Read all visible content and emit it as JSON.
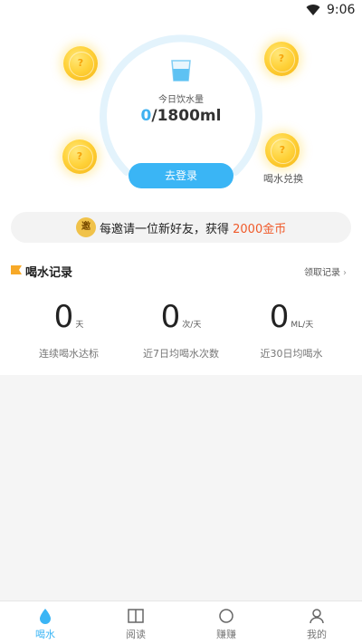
{
  "status_bar": {
    "time": "9:06"
  },
  "water": {
    "today_label": "今日饮水量",
    "current": "0",
    "goal": "/1800ml",
    "login_label": "去登录",
    "exchange_label": "喝水兑换",
    "coin_mark": "?"
  },
  "invite": {
    "badge": "邀",
    "text": "每邀请一位新好友，获得 ",
    "reward": "2000金币"
  },
  "records": {
    "title": "喝水记录",
    "more_label": "领取记录",
    "stats": [
      {
        "value": "0",
        "unit": "天",
        "label": "连续喝水达标"
      },
      {
        "value": "0",
        "unit": "次/天",
        "label": "近7日均喝水次数"
      },
      {
        "value": "0",
        "unit": "ML/天",
        "label": "近30日均喝水"
      }
    ]
  },
  "tabs": [
    {
      "label": "喝水"
    },
    {
      "label": "阅读"
    },
    {
      "label": "赚赚"
    },
    {
      "label": "我的"
    }
  ],
  "colors": {
    "accent": "#3ab5f5",
    "reward": "#f05a2a",
    "coin": "#ffd23a"
  }
}
